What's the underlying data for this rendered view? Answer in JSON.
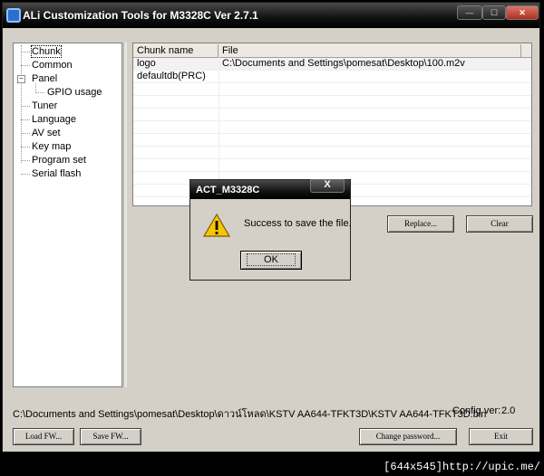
{
  "window": {
    "title": "ALi Customization Tools for M3328C  Ver 2.7.1"
  },
  "tree": {
    "items": [
      {
        "label": "Chunk"
      },
      {
        "label": "Common"
      },
      {
        "label": "Panel"
      },
      {
        "label": "GPIO usage"
      },
      {
        "label": "Tuner"
      },
      {
        "label": "Language"
      },
      {
        "label": "AV set"
      },
      {
        "label": "Key map"
      },
      {
        "label": "Program set"
      },
      {
        "label": "Serial flash"
      }
    ]
  },
  "list": {
    "columns": [
      "Chunk name",
      "File"
    ],
    "rows": [
      {
        "name": "logo",
        "file": "C:\\Documents and Settings\\pomesat\\Desktop\\100.m2v"
      },
      {
        "name": "defaultdb(PRC)",
        "file": ""
      }
    ]
  },
  "buttons": {
    "replace": "Replace...",
    "clear": "Clear",
    "load_fw": "Load FW...",
    "save_fw": "Save FW...",
    "change_password": "Change password...",
    "exit": "Exit"
  },
  "footer": {
    "path": "C:\\Documents and Settings\\pomesat\\Desktop\\ดาวน์โหลด\\KSTV AA644-TFKT3D\\KSTV AA644-TFKT3D.bin",
    "config_label": "Config ver:",
    "config_value": "2.0"
  },
  "dialog": {
    "title": "ACT_M3328C",
    "close_glyph": "X",
    "message": "Success to save the file.",
    "ok": "OK"
  },
  "watermark": "[644x545]http://upic.me/"
}
